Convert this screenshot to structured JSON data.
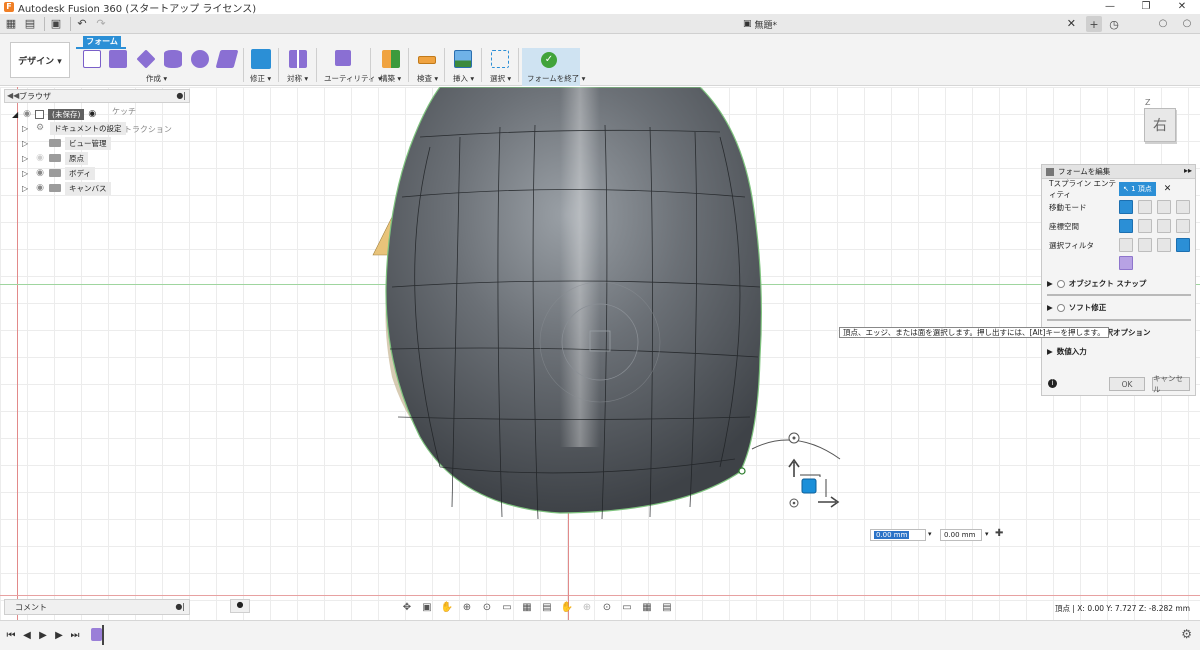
{
  "app": {
    "title": "Autodesk Fusion 360 (スタートアップ ライセンス)",
    "doc_title": "無題*",
    "window_controls": [
      "—",
      "❐",
      "✕"
    ]
  },
  "ribbon": {
    "workspace": "デザイン ▾",
    "active_tab": "フォーム",
    "groups": [
      {
        "label": "作成 ▾"
      },
      {
        "label": "修正 ▾"
      },
      {
        "label": "対称 ▾"
      },
      {
        "label": "ユーティリティ ▾"
      },
      {
        "label": "構築 ▾"
      },
      {
        "label": "検査 ▾"
      },
      {
        "label": "挿入 ▾"
      },
      {
        "label": "選択 ▾"
      },
      {
        "label": "フォームを終了 ▾"
      }
    ]
  },
  "browser": {
    "title": "ブラウザ",
    "root": "(未保存)",
    "ghost_sketch": "ケッチ",
    "ghost_illustration": "ンストラクション",
    "items": [
      {
        "label": "ドキュメントの設定"
      },
      {
        "label": "ビュー管理"
      },
      {
        "label": "原点"
      },
      {
        "label": "ボディ"
      },
      {
        "label": "キャンバス"
      }
    ]
  },
  "panel": {
    "title": "フォームを編集",
    "rows": {
      "entity": "Tスプライン エンティティ",
      "entity_value": "↖ 1 頂点",
      "move_mode": "移動モード",
      "coord_space": "座標空間",
      "select_filter": "選択フィルタ"
    },
    "sections": {
      "object_snap": "オブジェクト スナップ",
      "soft_mod": "ソフト修正",
      "select_option": "選択オプション",
      "numeric_input": "数値入力"
    },
    "ok": "OK",
    "cancel": "キャンセル"
  },
  "tooltip": "頂点、エッジ、または面を選択します。押し出すには、[Alt]キーを押します。",
  "inputs": {
    "x": "0.00 mm",
    "y": "0.00 mm"
  },
  "viewcube": {
    "face": "右",
    "axis": "Z"
  },
  "comments": "コメント",
  "status": "頂点 | X: 0.00 Y: 7.727 Z: -8.282 mm",
  "colors": {
    "accent": "#2b8fd6",
    "finish": "#41a33a",
    "surface": "#5d6167"
  }
}
